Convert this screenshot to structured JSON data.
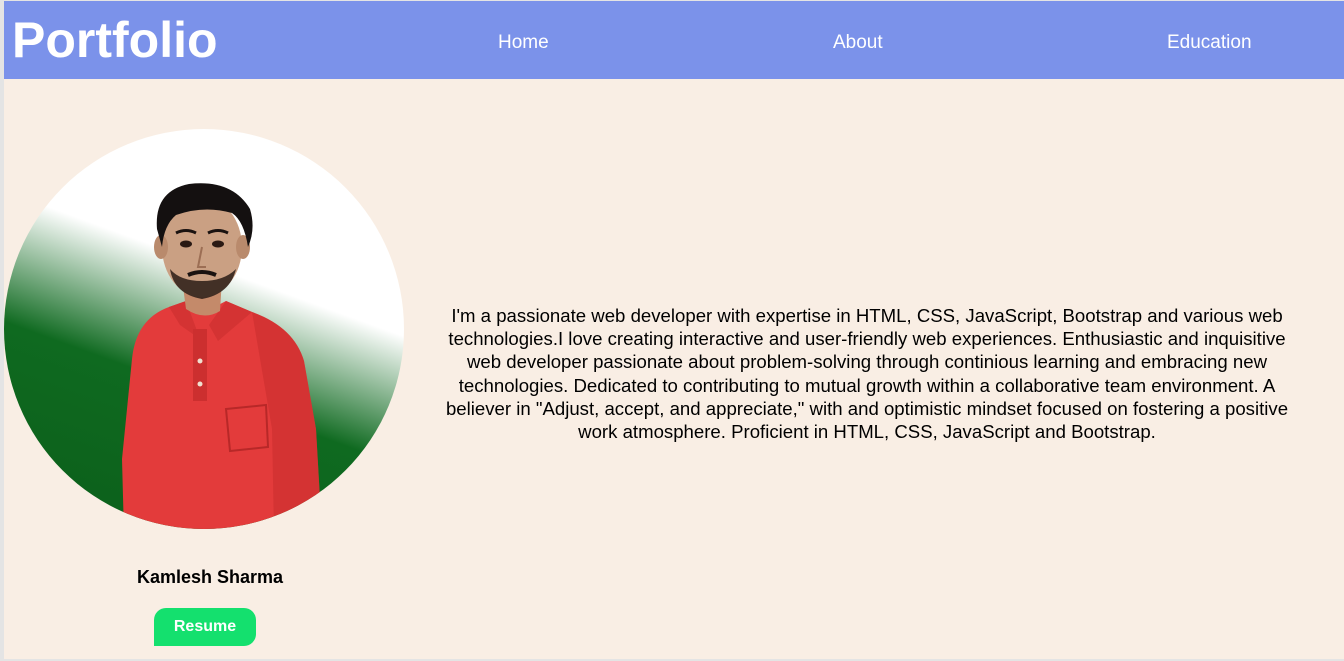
{
  "header": {
    "brand": "Portfolio",
    "nav": {
      "home": "Home",
      "about": "About",
      "education": "Education"
    }
  },
  "profile": {
    "name": "Kamlesh Sharma",
    "resume_label": "Resume",
    "photo_description_icon": "profile-photo"
  },
  "about": {
    "text": "I'm a passionate web developer with expertise in HTML, CSS, JavaScript, Bootstrap and various web technologies.I love creating interactive and user-friendly web experiences. Enthusiastic and inquisitive web developer passionate about problem-solving through continious learning and embracing new technologies. Dedicated to contributing to mutual growth within a collaborative team environment. A believer in \"Adjust, accept, and appreciate,\" with and optimistic mindset focused on fostering a positive work atmosphere. Proficient in HTML, CSS, JavaScript and Bootstrap."
  },
  "colors": {
    "navbar": "#7b92ea",
    "background": "#f9eee4",
    "resume_button": "#14e06e",
    "avatar_green": "#0b5e1a"
  }
}
